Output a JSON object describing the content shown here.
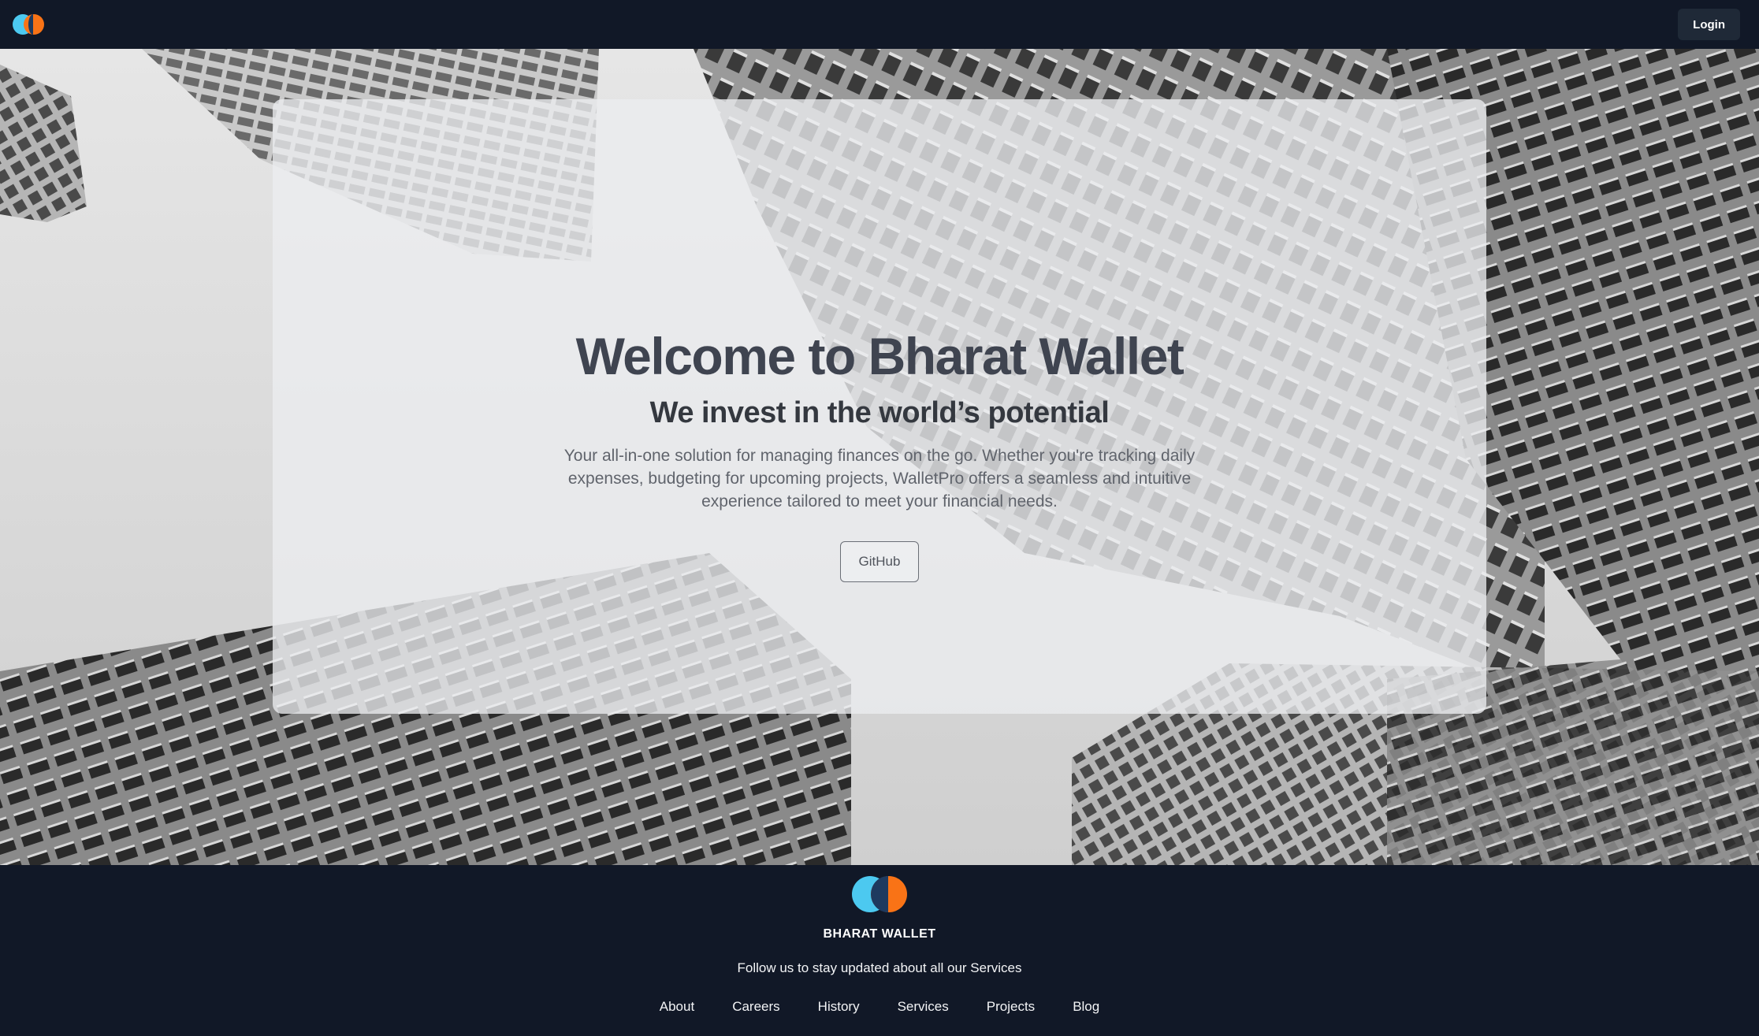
{
  "navbar": {
    "logo_icon": "bharat-wallet-logo",
    "login_label": "Login"
  },
  "hero": {
    "title": "Welcome to Bharat Wallet",
    "subtitle": "We invest in the world’s potential",
    "description": "Your all-in-one solution for managing finances on the go. Whether you're tracking daily expenses, budgeting for upcoming projects, WalletPro offers a seamless and intuitive experience tailored to meet your financial needs.",
    "github_label": "GitHub",
    "background": "skyscrapers-photo"
  },
  "footer": {
    "logo_icon": "bharat-wallet-logo",
    "brand_name": "BHARAT WALLET",
    "follow_text": "Follow us to stay updated about all our Services",
    "links": [
      "About",
      "Careers",
      "History",
      "Services",
      "Projects",
      "Blog"
    ]
  },
  "colors": {
    "background": "#111827",
    "accent_cyan": "#4cc9f0",
    "accent_orange": "#f97316",
    "login_button": "#1f2937"
  }
}
